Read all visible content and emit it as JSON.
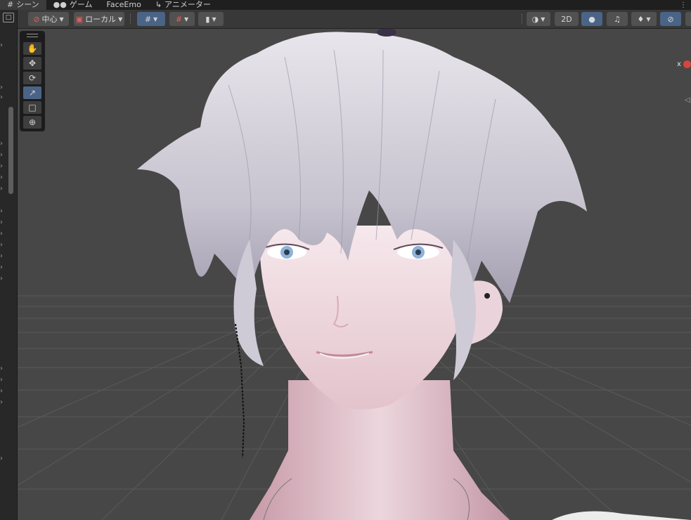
{
  "tabs": [
    {
      "label": "シーン",
      "icon": "grid-icon",
      "active": true
    },
    {
      "label": "ゲーム",
      "icon": "gamepad-icon",
      "active": false
    },
    {
      "label": "FaceEmo",
      "icon": "",
      "active": false
    },
    {
      "label": "アニメーター",
      "icon": "animator-icon",
      "active": false
    }
  ],
  "tabbar": {
    "menu_glyph": "⋮"
  },
  "toolbar": {
    "pivot_label": "中心",
    "space_label": "ローカル",
    "mode_2d_label": "2D"
  },
  "tools": [
    {
      "name": "hand-tool",
      "icon": "hand-icon",
      "active": false
    },
    {
      "name": "move-tool",
      "icon": "move-icon",
      "active": false
    },
    {
      "name": "rotate-tool",
      "icon": "rotate-icon",
      "active": false
    },
    {
      "name": "scale-tool",
      "icon": "scale-icon",
      "active": true
    },
    {
      "name": "rect-tool",
      "icon": "rect-icon",
      "active": false
    },
    {
      "name": "transform-tool",
      "icon": "transform-icon",
      "active": false
    }
  ],
  "gizmo": {
    "x_label": "x"
  },
  "colors": {
    "accent": "#4a6487",
    "scene_bg": "#474747",
    "toolbar_bg": "#383838",
    "tab_bg": "#1f1f1f",
    "gizmo_x": "#d6453d"
  },
  "scene": {
    "description_icon": "character-model-icon"
  }
}
